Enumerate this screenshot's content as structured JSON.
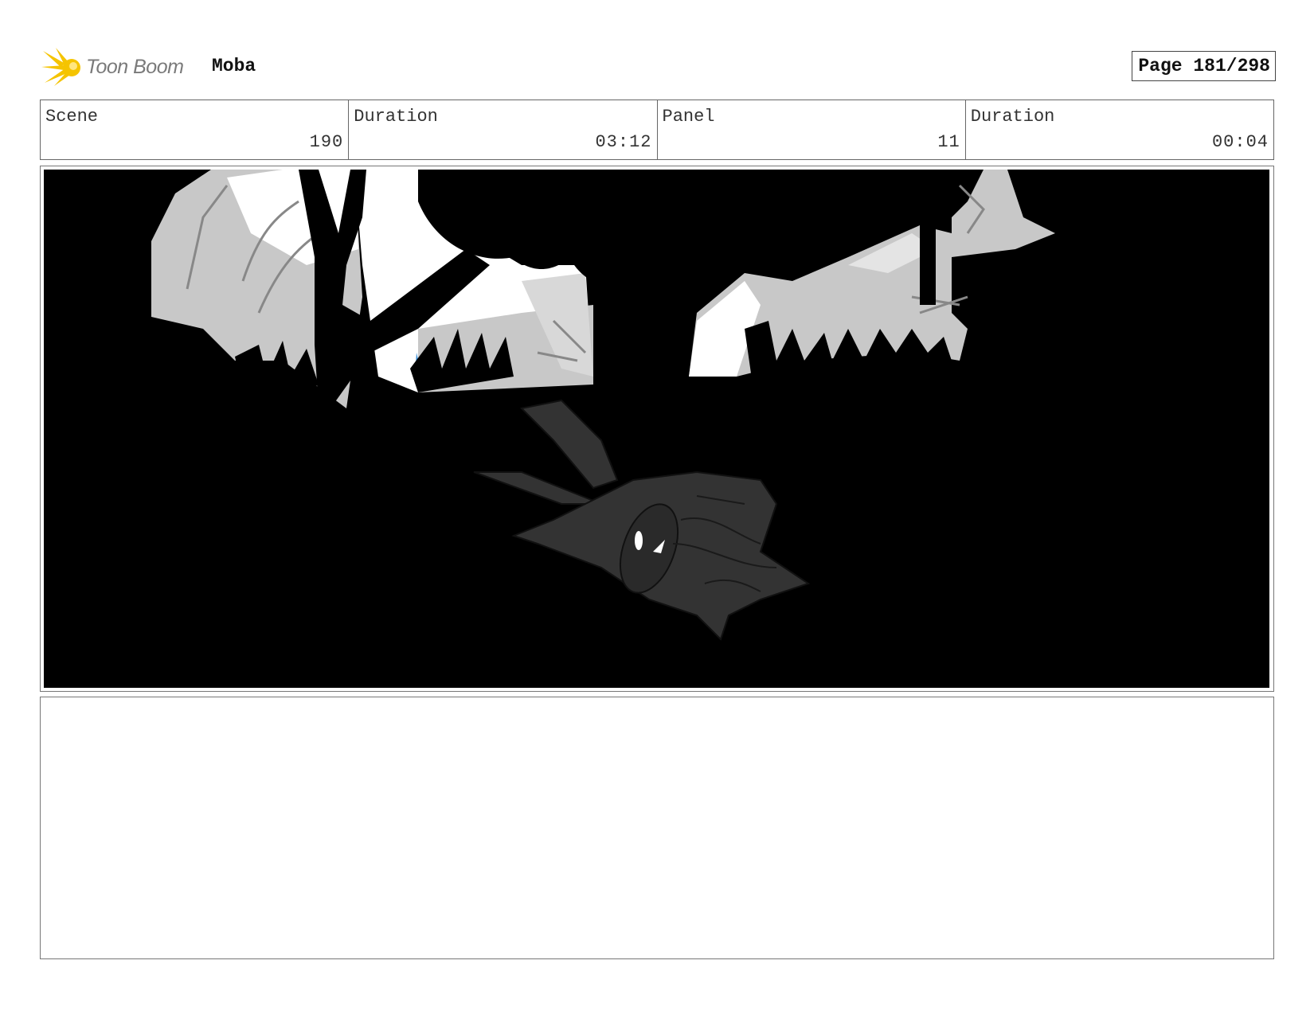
{
  "header": {
    "logo_text": "Toon Boom",
    "project_title": "Moba",
    "page_label": "Page 181/298"
  },
  "info": [
    {
      "label": "Scene",
      "value": "190"
    },
    {
      "label": "Duration",
      "value": "03:12"
    },
    {
      "label": "Panel",
      "value": "11"
    },
    {
      "label": "Duration",
      "value": "00:04"
    }
  ],
  "panel": {
    "description_icon": "storyboard-sketch-dark-forest-figure"
  },
  "notes": {
    "text": ""
  },
  "colors": {
    "logo_accent": "#f5c400",
    "panel_bg": "#000000",
    "foliage_grey": "#c8c8c8",
    "figure_grey": "#333333",
    "highlight_blue": "#3a8fd8"
  }
}
